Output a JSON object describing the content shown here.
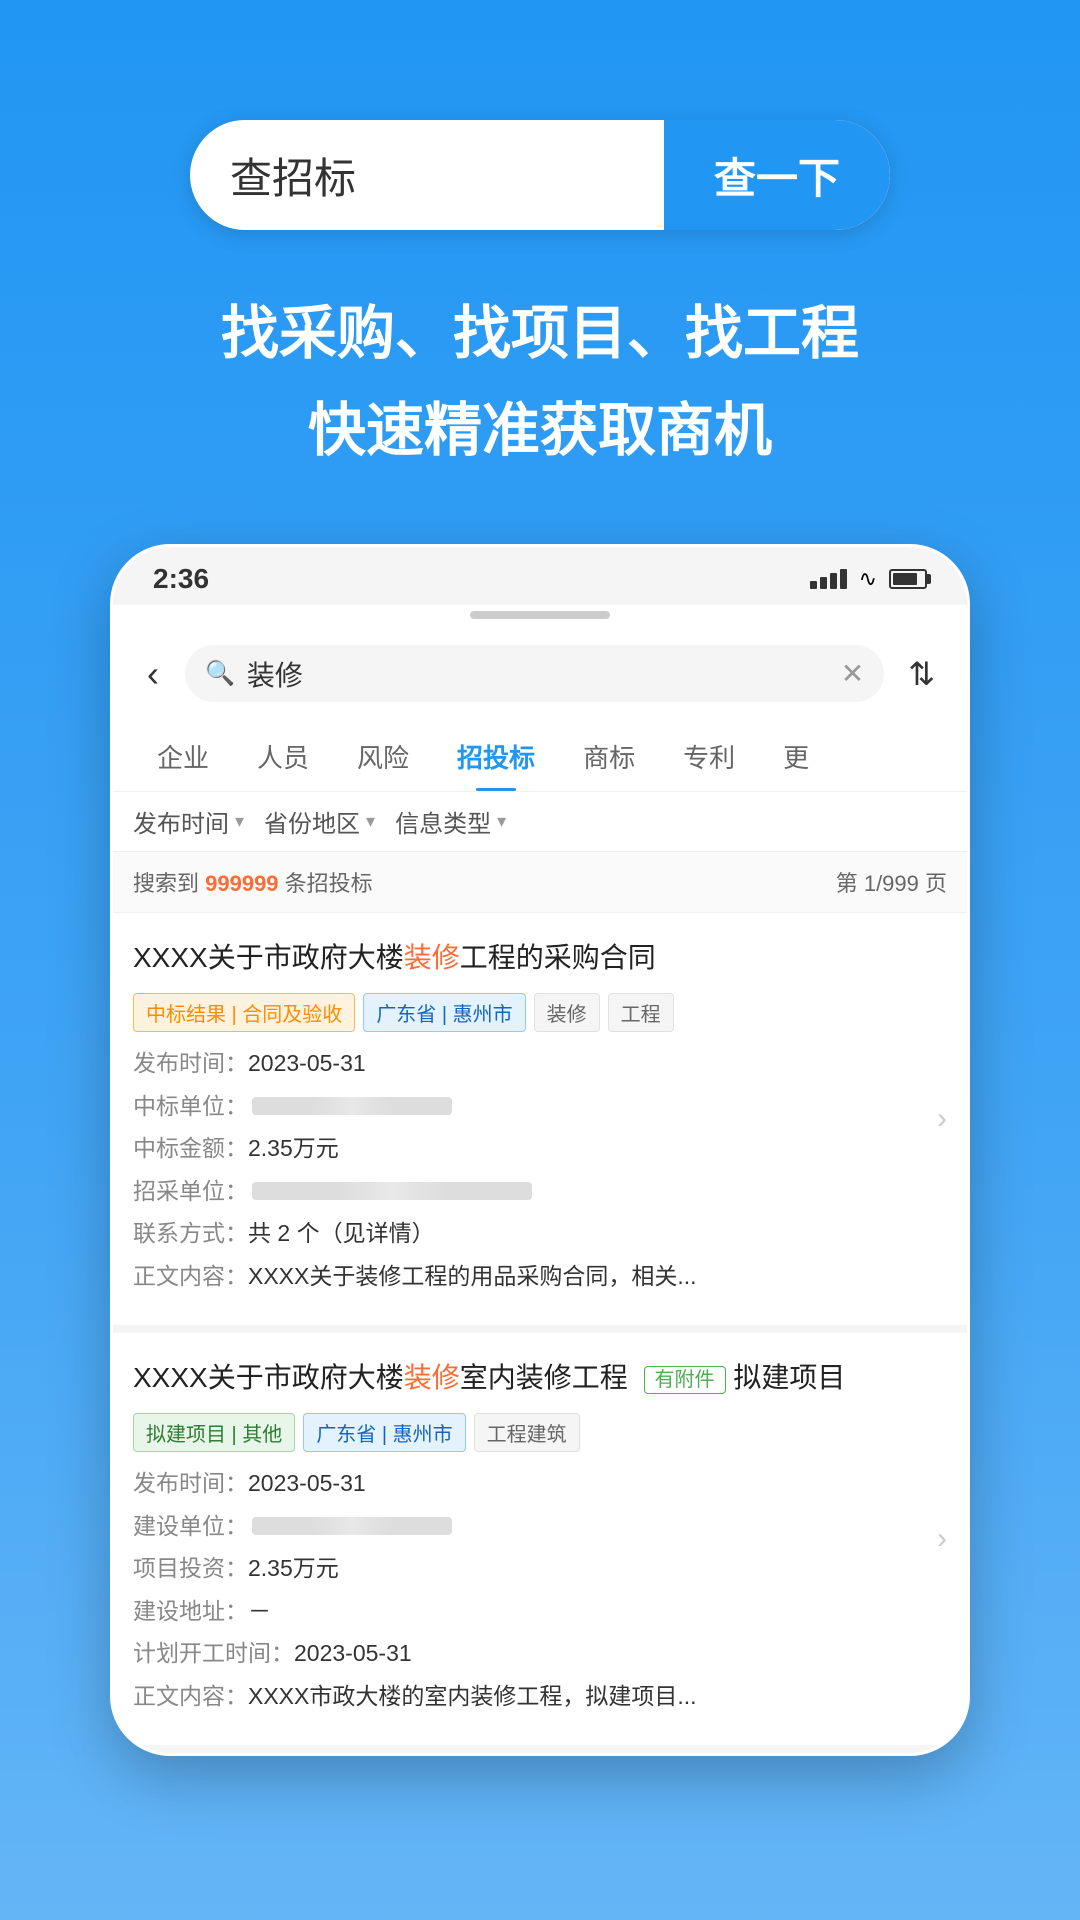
{
  "page": {
    "background": "#2196F3"
  },
  "search": {
    "input_placeholder": "查招标",
    "button_label": "查一下",
    "search_value": "查招标"
  },
  "tagline": {
    "line1": "找采购、找项目、找工程",
    "line2": "快速精准获取商机"
  },
  "phone": {
    "time": "2:36",
    "signal": "▌▌▌",
    "wifi": "📶",
    "battery": "🔋"
  },
  "app": {
    "search_value": "装修",
    "back_label": "‹",
    "filter_label": "↕",
    "clear_label": "✕",
    "tabs": [
      {
        "label": "企业",
        "active": false
      },
      {
        "label": "人员",
        "active": false
      },
      {
        "label": "风险",
        "active": false
      },
      {
        "label": "招投标",
        "active": true
      },
      {
        "label": "商标",
        "active": false
      },
      {
        "label": "专利",
        "active": false
      },
      {
        "label": "更",
        "active": false
      }
    ],
    "filters": [
      {
        "label": "发布时间",
        "arrow": "▾"
      },
      {
        "label": "省份地区",
        "arrow": "▾"
      },
      {
        "label": "信息类型",
        "arrow": "▾"
      }
    ],
    "results": {
      "prefix": "搜索到 ",
      "count": "999999",
      "suffix": " 条招投标",
      "page": "第 1/999 页"
    },
    "cards": [
      {
        "title_prefix": "XXXX关于市政府大楼",
        "title_highlight": "装修",
        "title_suffix": "工程的采购合同",
        "has_attachment": false,
        "badges": [
          {
            "text": "中标结果 | 合同及验收",
            "type": "orange"
          },
          {
            "text": "广东省 | 惠州市",
            "type": "blue"
          },
          {
            "text": "装修",
            "type": "gray"
          },
          {
            "text": "工程",
            "type": "gray"
          }
        ],
        "fields": [
          {
            "label": "发布时间：",
            "value": "2023-05-31",
            "blurred": false
          },
          {
            "label": "中标单位：",
            "value": "",
            "blurred": true,
            "blurred_size": "normal"
          },
          {
            "label": "中标金额：",
            "value": "2.35万元",
            "blurred": false
          },
          {
            "label": "招采单位：",
            "value": "",
            "blurred": true,
            "blurred_size": "long"
          },
          {
            "label": "联系方式：",
            "value": "共 2 个（见详情）",
            "blurred": false
          },
          {
            "label": "正文内容：",
            "value": "XXXX关于装修工程的用品采购合同，相关...",
            "blurred": false
          }
        ]
      },
      {
        "title_prefix": "XXXX关于市政府大楼",
        "title_highlight": "装修",
        "title_suffix": "室内装修工程拟建项目",
        "has_attachment": true,
        "attachment_label": "有附件",
        "badges": [
          {
            "text": "拟建项目 | 其他",
            "type": "green"
          },
          {
            "text": "广东省 | 惠州市",
            "type": "blue"
          },
          {
            "text": "工程建筑",
            "type": "gray"
          }
        ],
        "fields": [
          {
            "label": "发布时间：",
            "value": "2023-05-31",
            "blurred": false
          },
          {
            "label": "建设单位：",
            "value": "",
            "blurred": true,
            "blurred_size": "normal"
          },
          {
            "label": "项目投资：",
            "value": "2.35万元",
            "blurred": false
          },
          {
            "label": "建设地址：",
            "value": "－",
            "blurred": false
          },
          {
            "label": "计划开工时间：",
            "value": "2023-05-31",
            "blurred": false
          },
          {
            "label": "正文内容：",
            "value": "XXXX市政大楼的室内装修工程，拟建项目...",
            "blurred": false
          }
        ]
      }
    ]
  }
}
